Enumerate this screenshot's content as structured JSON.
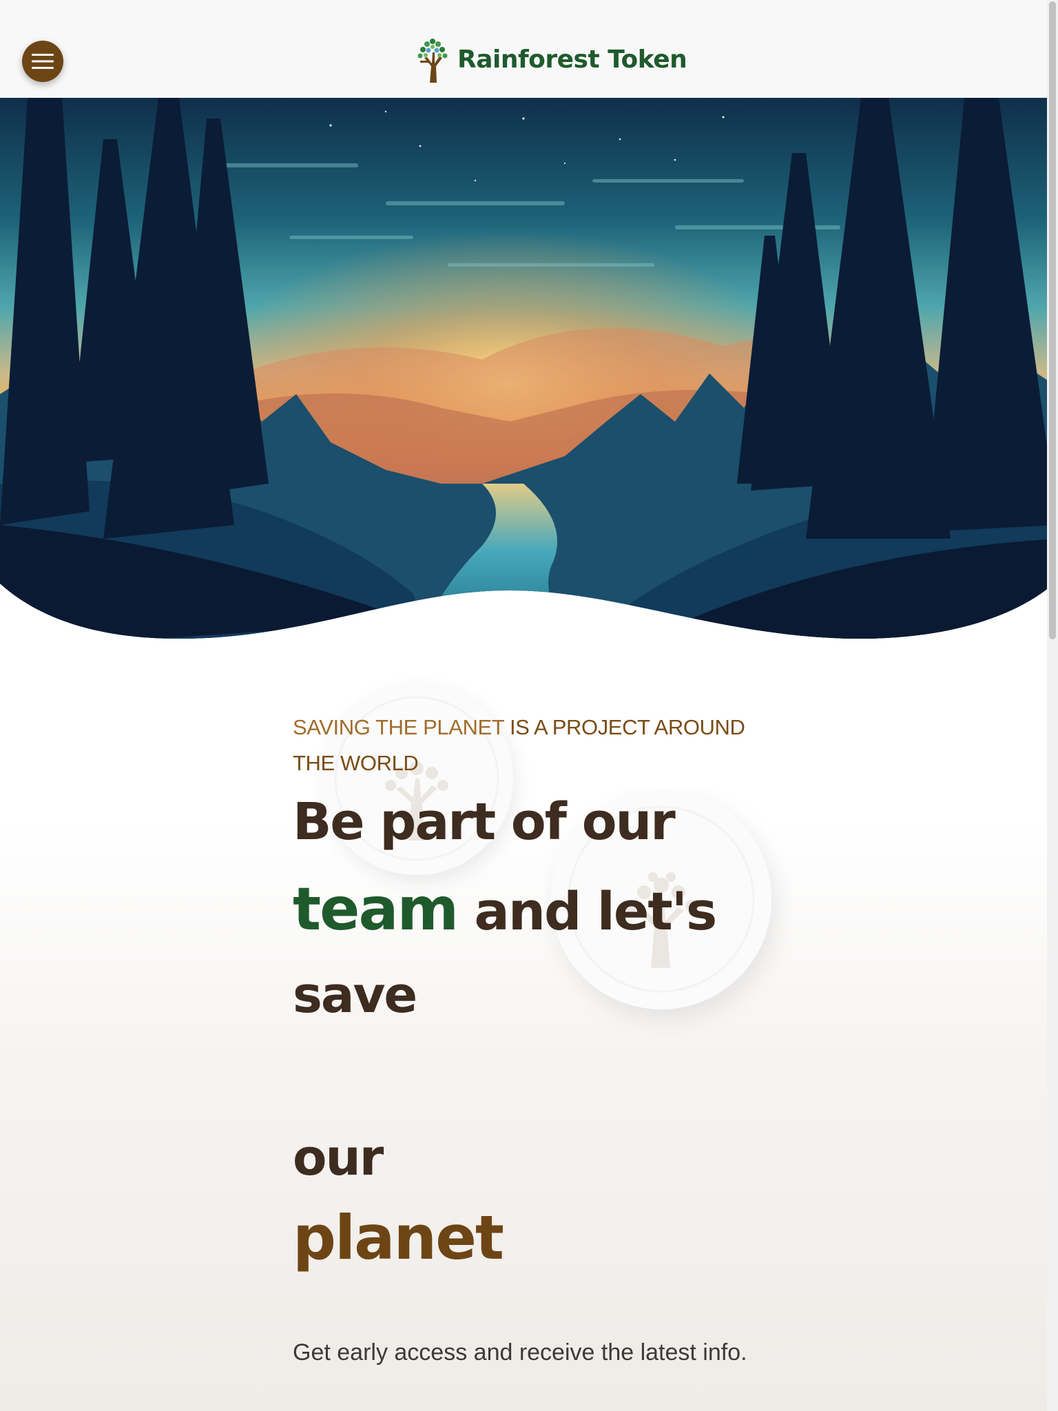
{
  "header": {
    "brand_name": "Rainforest Token",
    "menu_icon": "hamburger-menu-icon",
    "logo_icon": "tree-logo-icon"
  },
  "hero": {
    "illustration": "forest-sunset-river-illustration"
  },
  "main": {
    "eyebrow_highlight": "SAVING THE PLANET",
    "eyebrow_rest": " IS A PROJECT AROUND THE WORLD",
    "headline": {
      "line1": "Be part of our",
      "team_word": "team",
      "line2_rest": " and let's",
      "line3": "save",
      "line4": "our",
      "line5": "planet"
    },
    "subtext": "Get early access and receive the latest info."
  },
  "colors": {
    "brand_green": "#1f5a2d",
    "brand_brown": "#6d4515",
    "text_dark": "#3d2c1f"
  }
}
